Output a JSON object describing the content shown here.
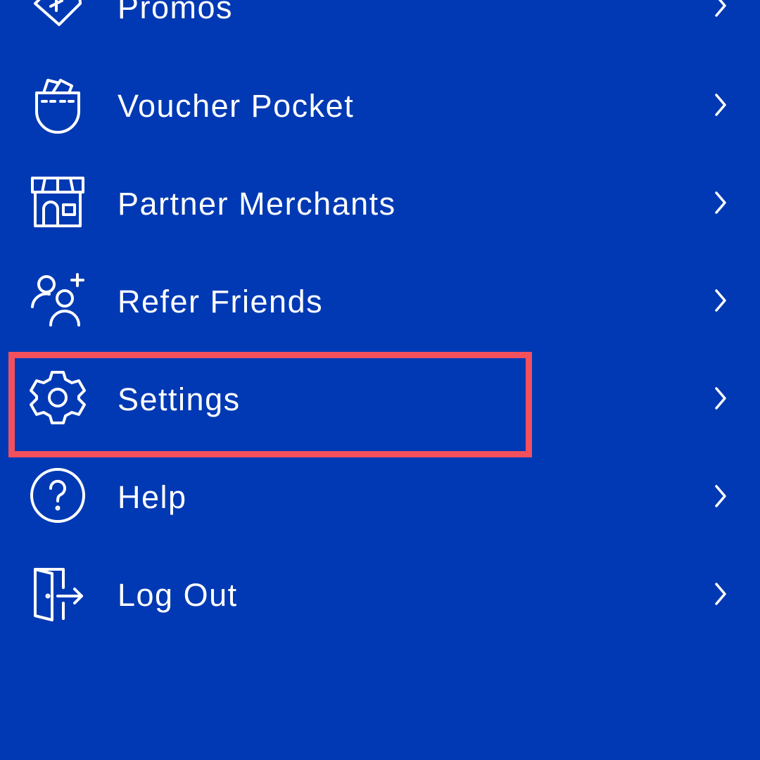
{
  "colors": {
    "background": "#0039B3",
    "foreground": "#FFFFFF",
    "highlight": "#F2505D"
  },
  "menu": {
    "items": [
      {
        "label": "Promos",
        "icon": "promo-tag-icon"
      },
      {
        "label": "Voucher Pocket",
        "icon": "voucher-pocket-icon"
      },
      {
        "label": "Partner Merchants",
        "icon": "storefront-icon"
      },
      {
        "label": "Refer Friends",
        "icon": "add-friends-icon"
      },
      {
        "label": "Settings",
        "icon": "gear-icon",
        "highlighted": true
      },
      {
        "label": "Help",
        "icon": "question-circle-icon"
      },
      {
        "label": "Log Out",
        "icon": "logout-door-icon"
      }
    ]
  }
}
